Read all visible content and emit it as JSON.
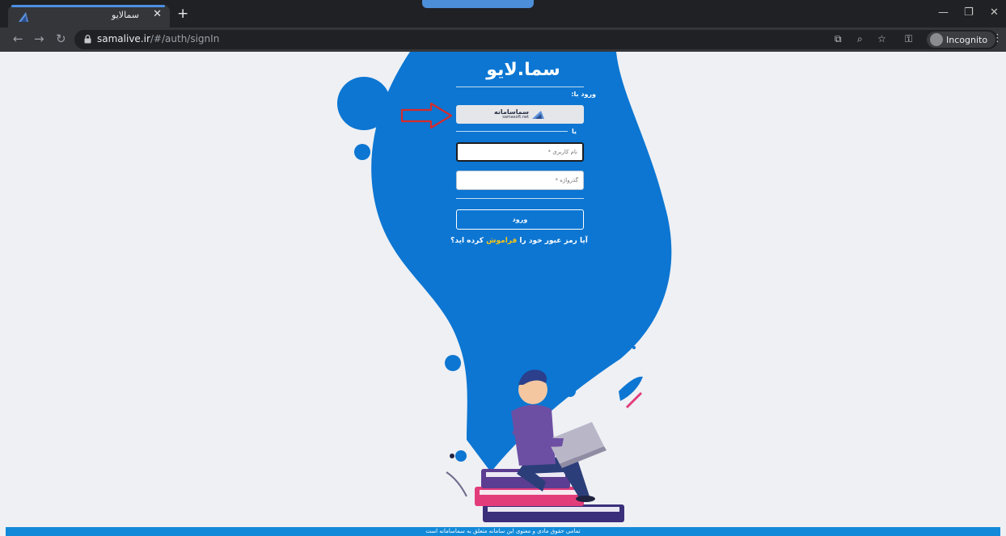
{
  "browser": {
    "tab_title": "سمالایو",
    "tab_close": "✕",
    "new_tab": "+",
    "window_controls": {
      "minimize": "—",
      "restore": "❐",
      "close": "✕"
    },
    "nav": {
      "back": "←",
      "forward": "→",
      "reload": "↻"
    },
    "url_host": "samalive.ir",
    "url_path": "/#/auth/signIn",
    "incognito_label": "Incognito",
    "icons": [
      "translate-icon",
      "zoom-icon",
      "star-icon",
      "key-icon",
      "incognito-icon",
      "menu-icon"
    ]
  },
  "page": {
    "brand": "سما.لایو",
    "login_with_label": "ورود با:",
    "sso_brand": "سماسامانه",
    "sso_domain": "samasoft.net",
    "or_label": "یا",
    "username_placeholder": "نام کاربری *",
    "password_placeholder": "گذرواژه *",
    "submit_label": "ورود",
    "forgot_prefix": "آیا رمز عبور خود را ",
    "forgot_link": "فراموش",
    "forgot_suffix": " کرده اید؟",
    "footer_text": "تمامی حقوق مادی و معنوی این سامانه متعلق به سماسامانه است"
  },
  "colors": {
    "blob": "#0c76d2",
    "footer": "#138ad9",
    "arrow": "#d62b2b",
    "link": "#f5c518"
  }
}
